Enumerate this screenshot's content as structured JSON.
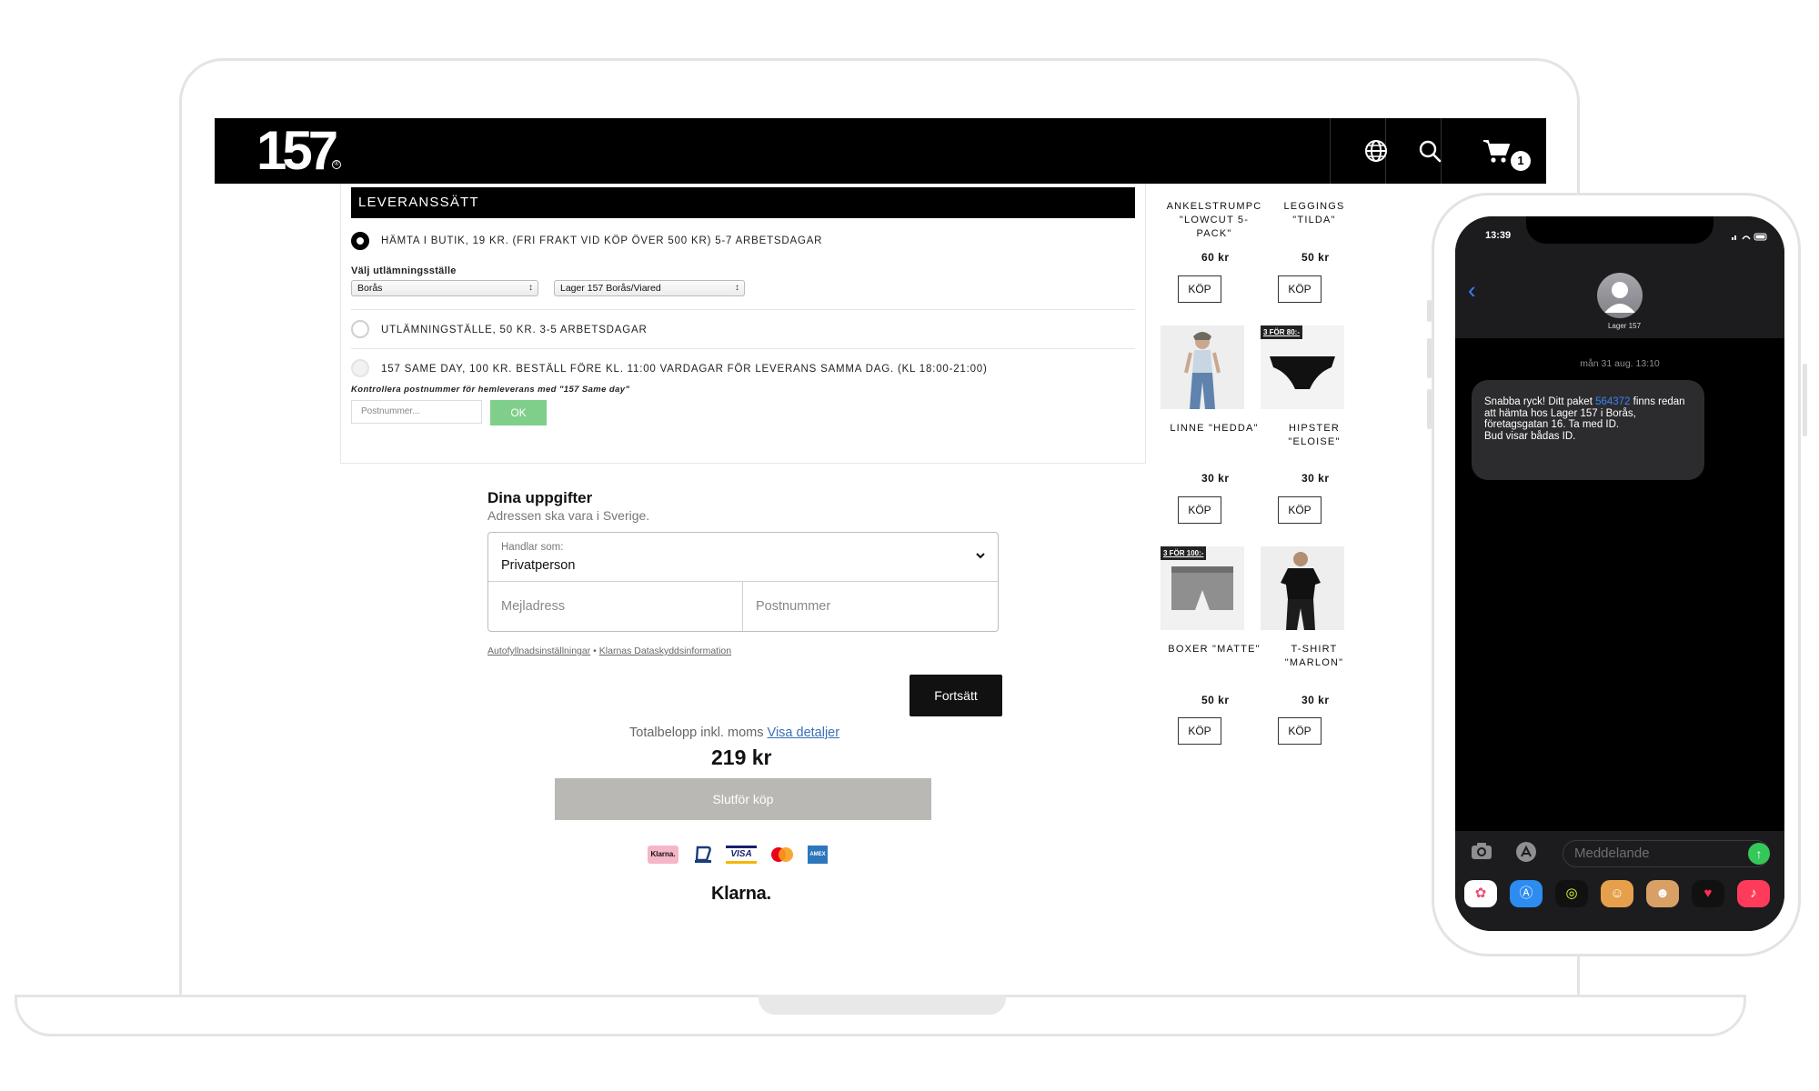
{
  "header": {
    "logo": "157",
    "logo_mark": "®",
    "cart_count": "1"
  },
  "delivery": {
    "section_title": "LEVERANSSÄTT",
    "option_pickup": "HÄMTA I BUTIK, 19 KR. (FRI FRAKT VID KÖP ÖVER 500 KR) 5-7 ARBETSDAGAR",
    "pickup_label": "Välj utlämningsställe",
    "city_select": "Borås",
    "store_select": "Lager 157 Borås/Viared",
    "option_point": "UTLÄMNINGSTÄLLE, 50 KR. 3-5 ARBETSDAGAR",
    "option_sameday": "157 SAME DAY, 100 KR. BESTÄLL FÖRE KL. 11:00 VARDAGAR FÖR LEVERANS SAMMA DAG. (KL 18:00-21:00)",
    "postcode_note": "Kontrollera postnummer för hemleverans med \"157 Same day\"",
    "postcode_placeholder": "Postnummer...",
    "ok_label": "OK"
  },
  "klarna": {
    "title": "Dina uppgifter",
    "subtitle": "Adressen ska vara i Sverige.",
    "buying_as_label": "Handlar som:",
    "buying_as_value": "Privatperson",
    "email_placeholder": "Mejladress",
    "postcode_placeholder": "Postnummer",
    "link_autofill": "Autofyllnadsinställningar",
    "link_separator": "•",
    "link_privacy": "Klarnas Dataskyddsinformation",
    "continue_label": "Fortsätt",
    "total_label": "Totalbelopp inkl. moms",
    "total_link": "Visa detaljer",
    "total_amount": "219 kr",
    "finish_label": "Slutför köp",
    "pay_klarna": "Klarna.",
    "pay_visa": "VISA",
    "pay_amex": "AMEX",
    "brand": "Klarna."
  },
  "products": [
    {
      "name": "ANKELSTRUMPC \"LOWCUT 5-PACK\"",
      "price": "60 kr",
      "buy": "KÖP"
    },
    {
      "name": "LEGGINGS \"TILDA\"",
      "price": "50 kr",
      "buy": "KÖP"
    },
    {
      "name": "LINNE \"HEDDA\"",
      "price": "30 kr",
      "buy": "KÖP"
    },
    {
      "name": "HIPSTER \"ELOISE\"",
      "price": "30 kr",
      "buy": "KÖP",
      "promo": "3 FÖR 80:-"
    },
    {
      "name": "BOXER \"MATTE\"",
      "price": "50 kr",
      "buy": "KÖP",
      "promo": "3 FÖR 100:-"
    },
    {
      "name": "T-SHIRT \"MARLON\"",
      "price": "30 kr",
      "buy": "KÖP"
    }
  ],
  "phone": {
    "time": "13:39",
    "contact": "Lager 157",
    "date": "mån 31 aug. 13:10",
    "msg_part1": "Snabba ryck! Ditt paket ",
    "msg_link": "564372",
    "msg_part2": " finns redan att hämta hos Lager 157 i Borås, företagsgatan 16. Ta med ID.",
    "msg_part3": "Bud visar bådas ID.",
    "input_placeholder": "Meddelande"
  }
}
